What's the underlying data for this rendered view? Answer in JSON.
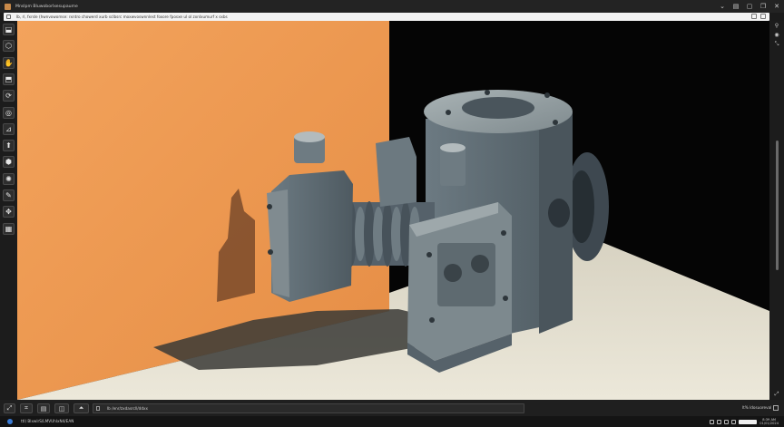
{
  "window": {
    "title": "Mnslpm Bluwoborlxesupaume",
    "controls": [
      "dropdown-icon",
      "save-icon",
      "square-icon",
      "restore-icon",
      "close-icon"
    ]
  },
  "address_bar": {
    "url": "lb, rl, fxrsle (hwnvowomse: rxntro chowerd xurb sclbsrc moxwvoswnnlest foxore fposxe ul ol zxnlxumurf x sxbs"
  },
  "left_tools": [
    {
      "name": "select-tool",
      "glyph": "⬓"
    },
    {
      "name": "lasso-tool",
      "glyph": "⬡"
    },
    {
      "name": "hand-tool",
      "glyph": "✋"
    },
    {
      "name": "box-tool",
      "glyph": "⬒"
    },
    {
      "name": "rotate-tool",
      "glyph": "⟳"
    },
    {
      "name": "orbit-tool",
      "glyph": "◎"
    },
    {
      "name": "measure-tool",
      "glyph": "⊿"
    },
    {
      "name": "extrude-tool",
      "glyph": "⬆"
    },
    {
      "name": "mesh-tool",
      "glyph": "⬢"
    },
    {
      "name": "sculpt-tool",
      "glyph": "✺"
    },
    {
      "name": "paint-tool",
      "glyph": "✎"
    },
    {
      "name": "transform-tool",
      "glyph": "✥"
    },
    {
      "name": "grid-tool",
      "glyph": "▦"
    }
  ],
  "right_tools": [
    "pin-icon",
    "eye-icon",
    "collapse-icon"
  ],
  "bottom_tools": [
    {
      "name": "expand-button",
      "glyph": "⤢"
    },
    {
      "name": "snap-button",
      "glyph": "⌗"
    },
    {
      "name": "layer-button",
      "glyph": "▤"
    },
    {
      "name": "camera-button",
      "glyph": "◫"
    },
    {
      "name": "render-button",
      "glyph": "⏶"
    }
  ],
  "path_field": {
    "text": "lb  /enr/zxdasrcll/ddxx"
  },
  "zoom_label": "lt% ldosuoreval",
  "status": {
    "text": "ttl) BlxwlrS/LMVUhlxN4/EAN",
    "clock_line1": "8:39 AM",
    "clock_line2": "01/01/2024"
  },
  "scene": {
    "wall_color": "#f09a52",
    "floor_color": "#e9e4d4",
    "back_color": "#050505",
    "part_color": "#5c6870"
  }
}
